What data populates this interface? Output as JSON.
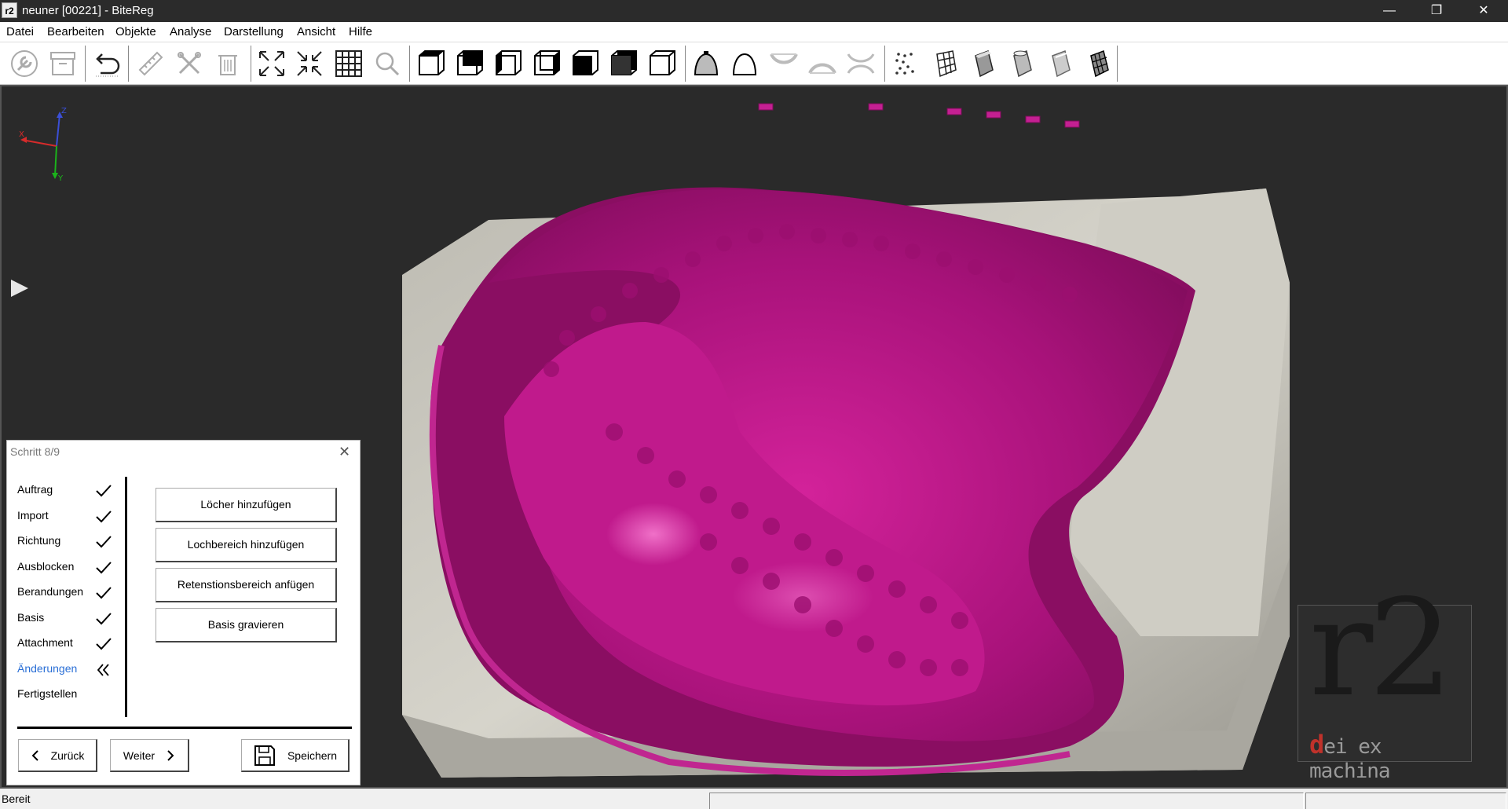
{
  "window": {
    "app_icon": "r2",
    "title": "neuner [00221] - BiteReg",
    "minimize_glyph": "—",
    "maximize_glyph": "❐",
    "close_glyph": "✕"
  },
  "menu": [
    "Datei",
    "Bearbeiten",
    "Objekte",
    "Analyse",
    "Darstellung",
    "Ansicht",
    "Hilfe"
  ],
  "toolbar": {
    "icons": [
      "wrench-icon",
      "archive-icon",
      "undo-icon",
      "ruler-icon",
      "cut-icon",
      "trash-icon",
      "expand-icon",
      "collapse-icon",
      "grid-icon",
      "zoom-icon",
      "view-front-icon",
      "view-back-icon",
      "view-left-icon",
      "view-right-icon",
      "view-top-icon",
      "view-bottom-icon",
      "view-iso-icon",
      "bell-shade-icon",
      "dome-icon",
      "upper-jaw-icon",
      "lower-jaw-icon",
      "both-jaws-icon",
      "points-icon",
      "mesh-icon",
      "cylinder-icon",
      "cylinder-solid-icon",
      "cylinder-smooth-icon",
      "cylinder-wire-icon"
    ]
  },
  "viewport": {
    "axis": {
      "z": "Z",
      "x": "X",
      "y": "Y"
    },
    "logo_big": "r2",
    "logo_accent": "d",
    "logo_rest": "ei ex machina"
  },
  "panel": {
    "title": "Schritt 8/9",
    "close_glyph": "✕",
    "steps": [
      {
        "label": "Auftrag",
        "state": "done"
      },
      {
        "label": "Import",
        "state": "done"
      },
      {
        "label": "Richtung",
        "state": "done"
      },
      {
        "label": "Ausblocken",
        "state": "done"
      },
      {
        "label": "Berandungen",
        "state": "done"
      },
      {
        "label": "Basis",
        "state": "done"
      },
      {
        "label": "Attachment",
        "state": "done"
      },
      {
        "label": "Änderungen",
        "state": "active"
      },
      {
        "label": "Fertigstellen",
        "state": "pending"
      }
    ],
    "actions": [
      "Löcher hinzufügen",
      "Lochbereich hinzufügen",
      "Retenstionsbereich anfügen",
      "Basis gravieren"
    ],
    "back_label": "Zurück",
    "next_label": "Weiter",
    "save_label": "Speichern",
    "accent": "#2a6fd6"
  },
  "status": {
    "text": "Bereit"
  },
  "colors": {
    "model_magenta": "#b5177f",
    "model_stone": "#c8c6bd",
    "viewport_bg": "#2a2a2a"
  }
}
